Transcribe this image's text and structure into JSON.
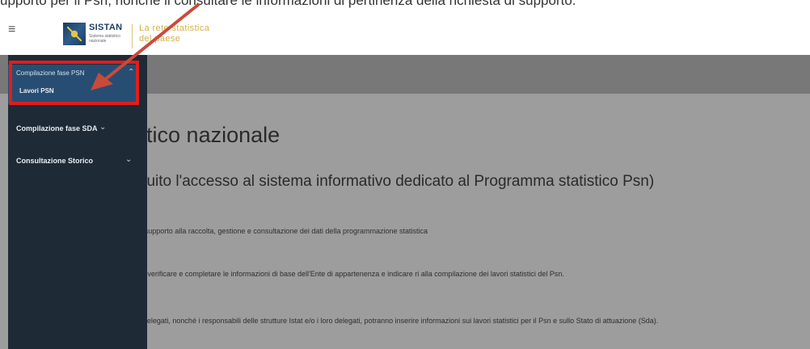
{
  "top_strip_text": "upporto per il Psn, nonché il consultare le informazioni di pertinenza della richiesta di supporto.",
  "header": {
    "logo_title": "SISTAN",
    "logo_subtitle": "Sistema statistico nazionale",
    "tagline_line1": "La rete statistica",
    "tagline_line2": "del paese"
  },
  "sidebar": {
    "groups": [
      {
        "label": "Compilazione fase PSN",
        "items": [
          "Lavori PSN"
        ]
      },
      {
        "label": "Compilazione fase SDA"
      },
      {
        "label": "Consultazione Storico"
      }
    ]
  },
  "main": {
    "title": "nma statistico nazionale",
    "subtitle": "o ha eseguito l'accesso al sistema informativo dedicato al Programma statistico Psn)",
    "para1": "ente l'accesso alle funzioni di supporto alla raccolta, gestione e consultazione dei dati della programmazione statistica",
    "para2": "egli uffici di statistica potranno verificare e completare le informazioni di base dell'Ente di appartenenza e indicare ri alla compilazione dei lavori statistici del Psn.",
    "para3": "egli uffici di statistica e/o loro delegati, nonché i responsabili delle strutture Istat e/o i loro delegati, potranno inserire informazioni sui lavori statistici per il Psn e sullo Stato di attuazione (Sda)."
  },
  "colors": {
    "sidebar_bg": "#1e2a36",
    "highlight": "#e11d1d",
    "arrow": "#c94a3a",
    "tagline": "#d4b04a"
  }
}
